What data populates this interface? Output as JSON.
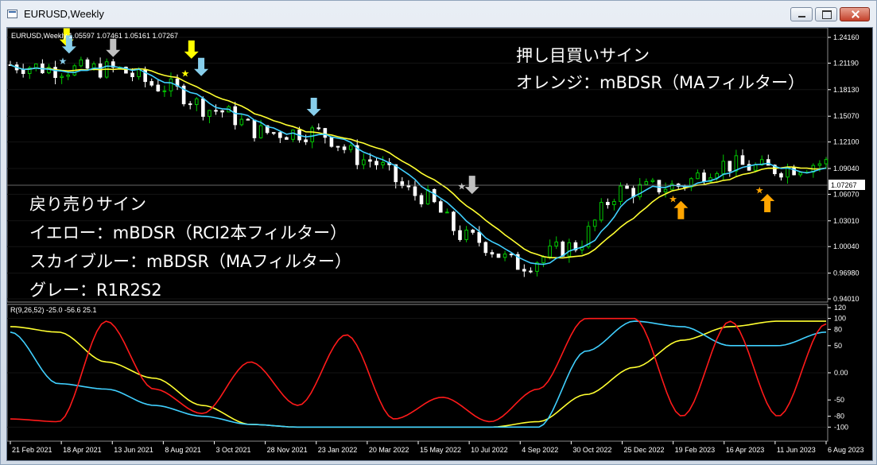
{
  "window": {
    "title": "EURUSD,Weekly",
    "controls": [
      "minimize-icon",
      "maximize-icon",
      "close-icon"
    ]
  },
  "chart": {
    "header": "EURUSD,Weekly  1.05597 1.07461 1.05161 1.07267",
    "current_price_label": "1.07267",
    "price_axis": [
      "1.24160",
      "1.21190",
      "1.18130",
      "1.15070",
      "1.12100",
      "1.09040",
      "1.06070",
      "1.03010",
      "1.00040",
      "0.96980",
      "0.94010"
    ],
    "date_axis": [
      "21 Feb 2021",
      "18 Apr 2021",
      "13 Jun 2021",
      "8 Aug 2021",
      "3 Oct 2021",
      "28 Nov 2021",
      "23 Jan 2022",
      "20 Mar 2022",
      "15 May 2022",
      "10 Jul 2022",
      "4 Sep 2022",
      "30 Oct 2022",
      "25 Dec 2022",
      "19 Feb 2023",
      "16 Apr 2023",
      "11 Jun 2023",
      "6 Aug 2023"
    ],
    "colors": {
      "bull": "#00c800",
      "bear": "#ffffff",
      "ma_fast": "#40d0ff",
      "ma_slow": "#ffff30",
      "rci_red": "#ff1a1a",
      "arrow_yellow": "#ffff00",
      "arrow_skyblue": "#87ceeb",
      "arrow_gray": "#c0c0c0",
      "arrow_orange": "#ffa500"
    }
  },
  "annotations": {
    "buy_title": "押し目買いサイン",
    "buy_line1": "オレンジ：mBDSR（MAフィルター）",
    "sell_title": "戻り売りサイン",
    "sell_line1": "イエロー：mBDSR（RCI2本フィルター）",
    "sell_line2": "スカイブルー：mBDSR（MAフィルター）",
    "sell_line3": "グレー：R1R2S2"
  },
  "indicator": {
    "header": "R(9,26,52) -25.0 -56.6 25.1",
    "axis": [
      "120",
      "100",
      "80",
      "50",
      "0.00",
      "-50",
      "-80",
      "-100"
    ]
  },
  "chart_data": {
    "type": "candlestick",
    "symbol": "EURUSD",
    "timeframe": "Weekly",
    "last_ohlc": {
      "open": 1.05597,
      "high": 1.07461,
      "low": 1.05161,
      "close": 1.07267
    },
    "ylim": [
      0.9401,
      1.2416
    ],
    "x_range": [
      "21 Feb 2021",
      "6 Aug 2023"
    ],
    "close_points": [
      [
        "21 Feb 2021",
        1.21
      ],
      [
        "18 Apr 2021",
        1.205
      ],
      [
        "13 Jun 2021",
        1.205
      ],
      [
        "8 Aug 2021",
        1.185
      ],
      [
        "3 Oct 2021",
        1.158
      ],
      [
        "28 Nov 2021",
        1.132
      ],
      [
        "23 Jan 2022",
        1.132
      ],
      [
        "20 Mar 2022",
        1.1
      ],
      [
        "15 May 2022",
        1.06
      ],
      [
        "10 Jul 2022",
        1.01
      ],
      [
        "4 Sep 2022",
        0.98
      ],
      [
        "30 Oct 2022",
        1.0
      ],
      [
        "25 Dec 2022",
        1.065
      ],
      [
        "19 Feb 2023",
        1.07
      ],
      [
        "16 Apr 2023",
        1.095
      ],
      [
        "11 Jun 2023",
        1.09
      ],
      [
        "6 Aug 2023",
        1.097
      ]
    ],
    "indicator_ylim": [
      -120,
      120
    ],
    "indicator_series": [
      {
        "name": "red",
        "values": [
          -85,
          -90,
          95,
          -30,
          -75,
          20,
          -60,
          70,
          -85,
          -45,
          -90,
          -30,
          100,
          100,
          -80,
          95,
          -80,
          90
        ]
      },
      {
        "name": "cyan",
        "values": [
          75,
          -20,
          -30,
          -60,
          -80,
          -95,
          -100,
          -100,
          -100,
          -100,
          -100,
          -100,
          40,
          95,
          85,
          50,
          50,
          75
        ]
      },
      {
        "name": "yellow",
        "values": [
          85,
          75,
          20,
          -10,
          -60,
          -95,
          -100,
          -100,
          -100,
          -100,
          -100,
          -90,
          -40,
          10,
          60,
          85,
          95,
          95
        ]
      }
    ]
  }
}
